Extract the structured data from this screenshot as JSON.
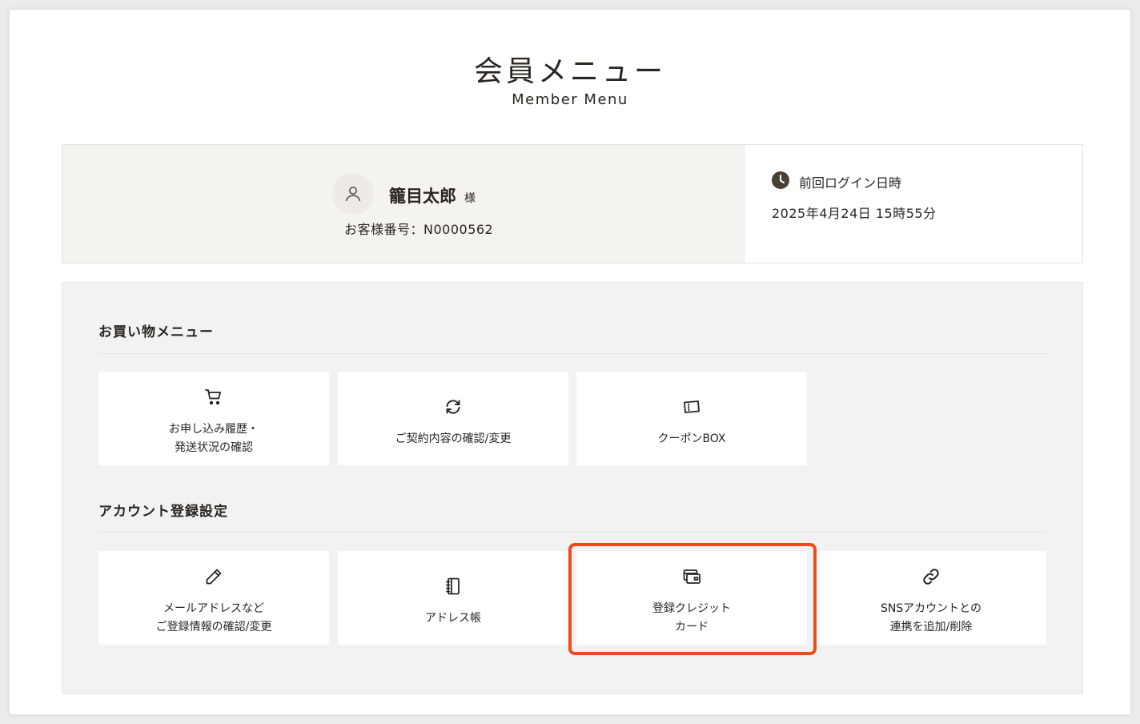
{
  "header": {
    "title": "会員メニュー",
    "subtitle": "Member Menu"
  },
  "profile": {
    "name": "籠目太郎",
    "honorific": "様",
    "customer_number": "お客様番号：N0000562",
    "avatar_icon": "user-icon"
  },
  "last_login": {
    "label": "前回ログイン日時",
    "value": "2025年4月24日 15時55分",
    "icon": "clock-icon"
  },
  "shopping_menu": {
    "title": "お買い物メニュー",
    "items": [
      {
        "label": "お申し込み履歴・\n発送状況の確認",
        "icon": "cart-icon"
      },
      {
        "label": "ご契約内容の確認/変更",
        "icon": "refresh-icon"
      },
      {
        "label": "クーポンBOX",
        "icon": "ticket-icon"
      }
    ]
  },
  "account_settings": {
    "title": "アカウント登録設定",
    "items": [
      {
        "label": "メールアドレスなど\nご登録情報の確認/変更",
        "icon": "pencil-icon"
      },
      {
        "label": "アドレス帳",
        "icon": "address-book-icon"
      },
      {
        "label": "登録クレジット\nカード",
        "icon": "credit-card-icon"
      },
      {
        "label": "SNSアカウントとの\n連携を追加/削除",
        "icon": "link-icon"
      }
    ]
  },
  "colors": {
    "text": "#2a2520",
    "profile_bg": "#f5f3f0",
    "panel_bg": "#f2f2f2",
    "highlight": "#ee4a1c"
  }
}
